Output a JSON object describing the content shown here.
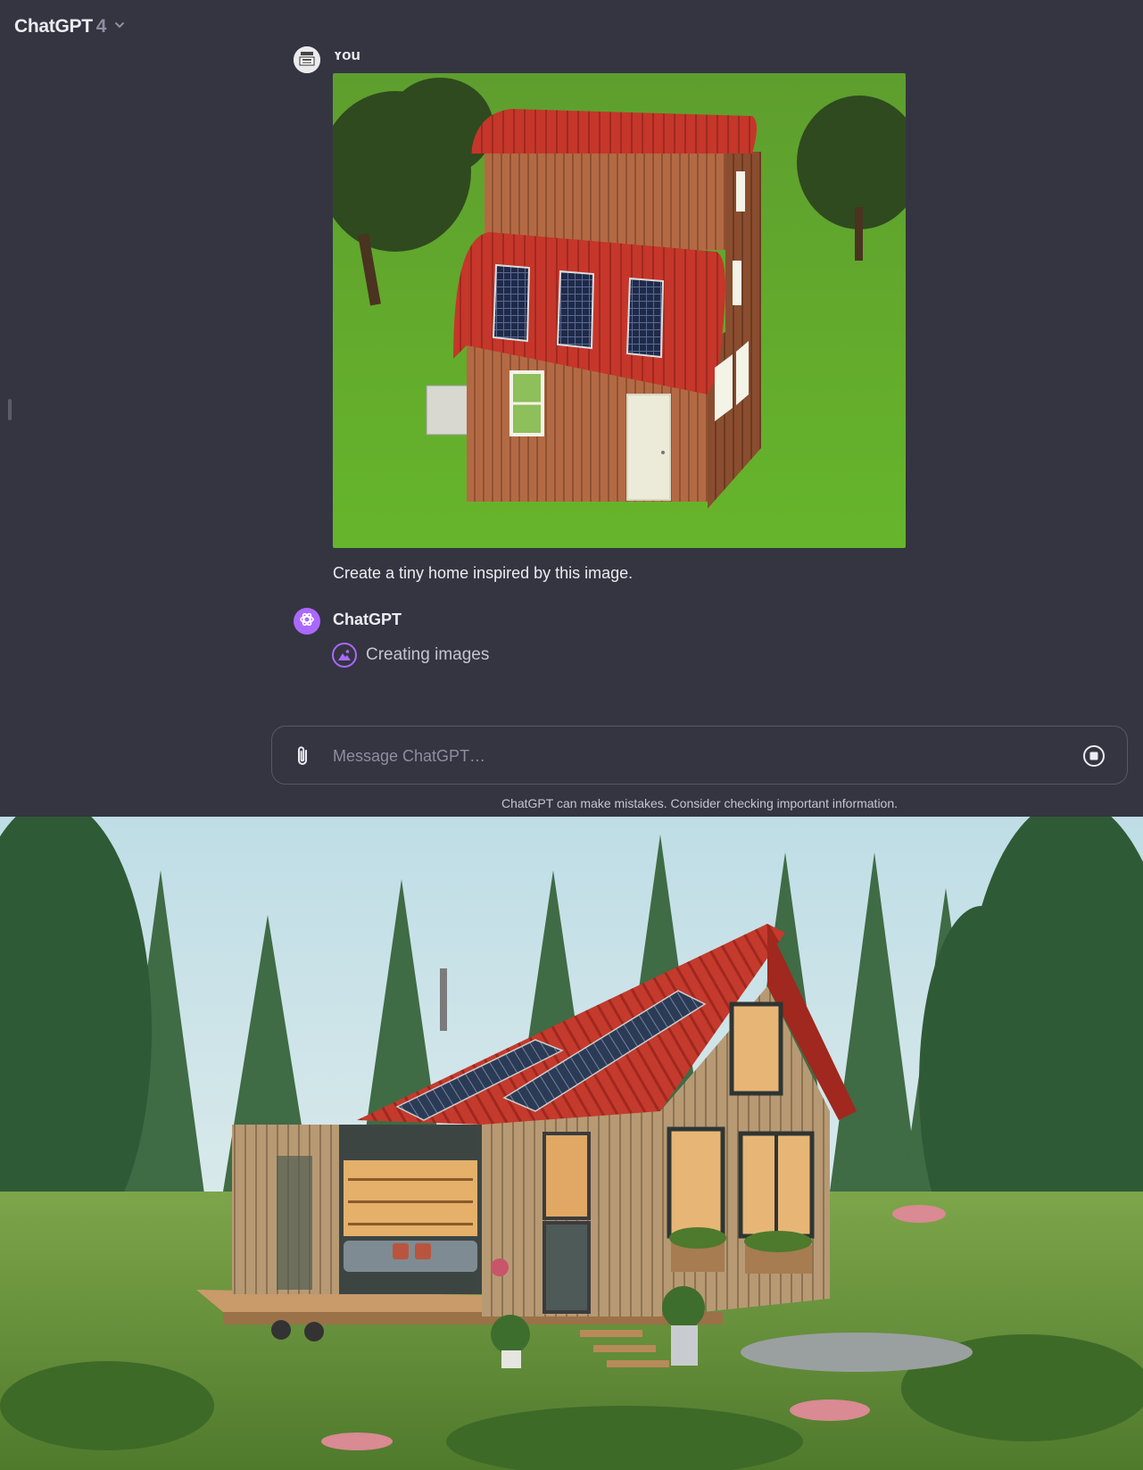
{
  "header": {
    "model_name": "ChatGPT",
    "model_version": "4"
  },
  "conversation": {
    "user": {
      "name": "You",
      "message": "Create a tiny home inspired by this image."
    },
    "assistant": {
      "name": "ChatGPT",
      "status": "Creating images"
    }
  },
  "composer": {
    "placeholder": "Message ChatGPT…"
  },
  "footer": {
    "disclaimer": "ChatGPT can make mistakes. Consider checking important information."
  },
  "colors": {
    "background": "#343541",
    "assistant_accent": "#ab68ff",
    "border": "#565869"
  },
  "icons": [
    "chevron-down-icon",
    "paperclip-icon",
    "stop-icon",
    "openai-logo-icon",
    "image-icon"
  ]
}
